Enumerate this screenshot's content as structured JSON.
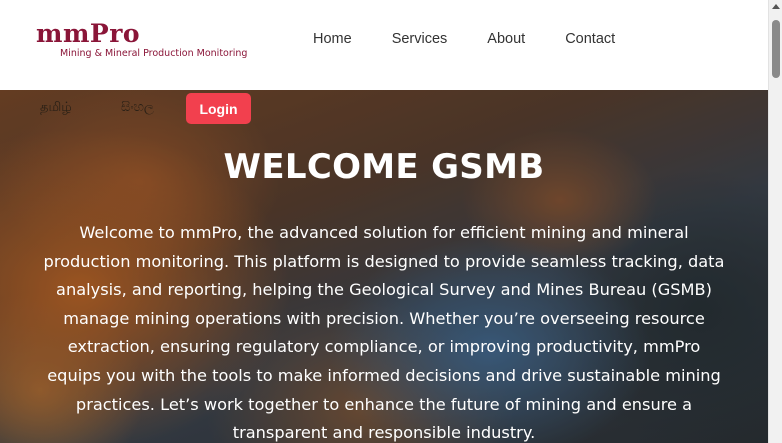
{
  "header": {
    "logo_text": "mmPro",
    "logo_tagline": "Mining & Mineral Production Monitoring",
    "nav": [
      "Home",
      "Services",
      "About",
      "Contact"
    ]
  },
  "hero": {
    "lang_tamil": "தமிழ்",
    "lang_sinhala": "සිංහල",
    "login_label": "Login",
    "title": "WELCOME GSMB",
    "text": "Welcome to mmPro, the advanced solution for efficient mining and mineral production monitoring. This platform is designed to provide seamless tracking, data analysis, and reporting, helping the Geological Survey and Mines Bureau (GSMB) manage mining operations with precision. Whether you’re overseeing resource extraction, ensuring regulatory compliance, or improving productivity, mmPro equips you with the tools to make informed decisions and drive sustainable mining practices. Let’s work together to enhance the future of mining and ensure a transparent and responsible industry."
  },
  "colors": {
    "brand": "#8a1538",
    "login_button": "#f2404e"
  }
}
